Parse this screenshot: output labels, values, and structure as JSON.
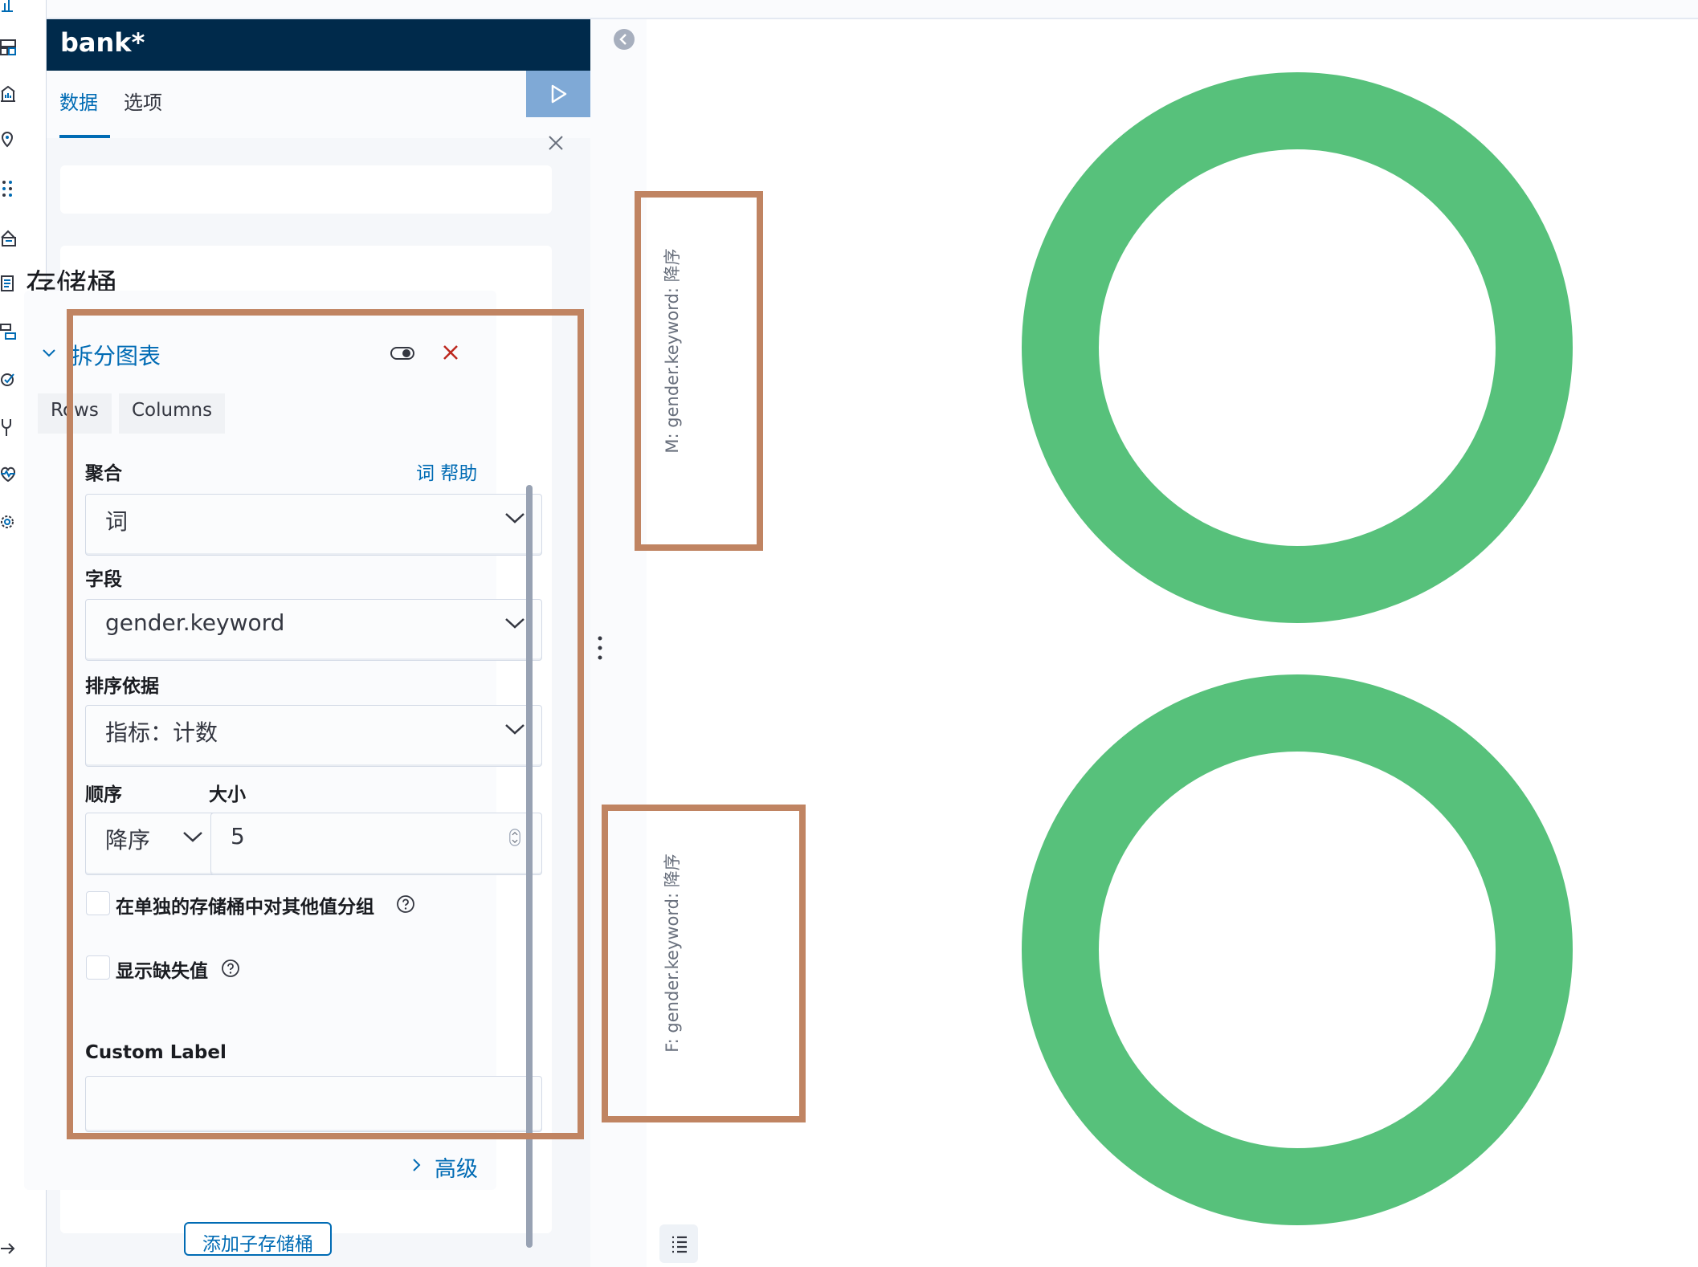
{
  "sidebar": {
    "index_pattern": "bank*",
    "tabs": [
      {
        "label": "数据",
        "active": true
      },
      {
        "label": "选项",
        "active": false
      }
    ],
    "buckets_title": "存储桶",
    "aggregation_panel": {
      "title": "拆分图表",
      "split_modes": [
        "Rows",
        "Columns"
      ],
      "aggregation": {
        "label": "聚合",
        "help_link": "词 帮助",
        "value": "词"
      },
      "field": {
        "label": "字段",
        "value": "gender.keyword"
      },
      "order_by": {
        "label": "排序依据",
        "value": "指标：计数"
      },
      "order": {
        "label": "顺序",
        "value": "降序"
      },
      "size": {
        "label": "大小",
        "value": "5"
      },
      "group_other_checkbox": {
        "label": "在单独的存储桶中对其他值分组",
        "checked": false
      },
      "show_missing_checkbox": {
        "label": "显示缺失值",
        "checked": false
      },
      "custom_label": {
        "label": "Custom Label",
        "value": ""
      },
      "advanced_link": "高级"
    },
    "add_sub_bucket_button": "添加子存储桶"
  },
  "chart": {
    "split_labels": [
      "M: gender.keyword: 降序",
      "F: gender.keyword: 降序"
    ]
  },
  "chart_data": {
    "type": "pie",
    "donut": true,
    "charts": [
      {
        "split_label": "M: gender.keyword: 降序",
        "values": [
          1
        ],
        "color": "#57c17b"
      },
      {
        "split_label": "F: gender.keyword: 降序",
        "values": [
          1
        ],
        "color": "#57c17b"
      }
    ]
  },
  "colors": {
    "header_bg": "#002a4b",
    "accent": "#006bb4",
    "donut": "#57c17b",
    "annotation": "#c08462",
    "remove": "#bd271e"
  }
}
